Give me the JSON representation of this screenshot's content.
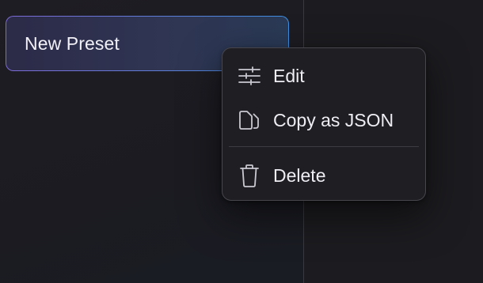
{
  "preset_card": {
    "title": "New Preset"
  },
  "context_menu": {
    "items": [
      {
        "label": "Edit",
        "icon": "sliders-icon"
      },
      {
        "label": "Copy as JSON",
        "icon": "copy-icon"
      },
      {
        "label": "Delete",
        "icon": "trash-icon"
      }
    ]
  },
  "colors": {
    "background": "#1c1b20",
    "menu_background": "#1f1f23",
    "card_border_start": "#7d6ad6",
    "card_border_end": "#3f8fe2"
  }
}
